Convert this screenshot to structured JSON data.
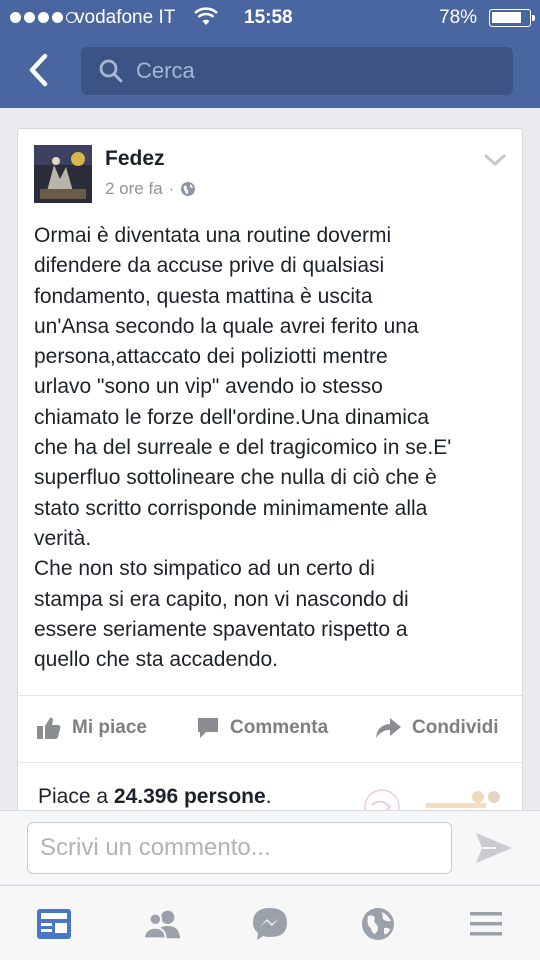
{
  "status_bar": {
    "carrier": "vodafone IT",
    "time": "15:58",
    "battery": "78%",
    "battery_level": 0.78
  },
  "nav": {
    "search_placeholder": "Cerca"
  },
  "post": {
    "author": "Fedez",
    "time_ago": "2 ore fa",
    "separator": "·",
    "text": "Ormai è diventata una routine dovermi\ndifendere da accuse prive di qualsiasi\nfondamento, questa mattina è uscita\nun'Ansa secondo la quale avrei ferito una\npersona,attaccato dei poliziotti mentre\nurlavo \"sono un vip\" avendo io stesso\nchiamato le forze dell'ordine.Una dinamica\nche ha del surreale e del tragicomico in se.E'\nsuperfluo sottolineare che nulla di ciò che è\nstato scritto corrisponde minimamente alla\nverità.\nChe non sto simpatico ad un certo di\nstampa si era capito, non vi nascondo di\nessere seriamente spaventato rispetto a\nquello che sta accadendo."
  },
  "actions": {
    "like": "Mi piace",
    "comment": "Commenta",
    "share": "Condividi"
  },
  "likes": {
    "prefix": "Piace a ",
    "count": "24.396 persone",
    "suffix": "."
  },
  "comment": {
    "placeholder": "Scrivi un commento..."
  },
  "tabs": [
    "news-feed",
    "friend-requests",
    "messenger",
    "notifications",
    "more"
  ],
  "colors": {
    "header_blue": "#4a66a0",
    "search_bg": "#3b5484",
    "active_tab": "#4a76c6",
    "inactive_tab": "#9aa1ab"
  }
}
